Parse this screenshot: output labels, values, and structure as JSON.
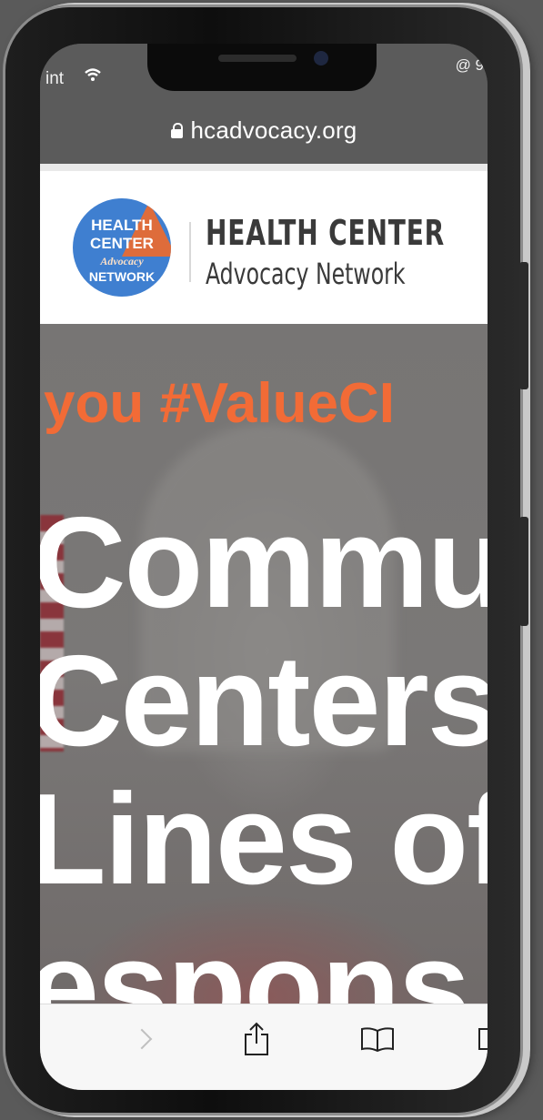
{
  "status_bar": {
    "carrier": "int",
    "battery": "@ 9"
  },
  "url_bar": {
    "domain": "hcadvocacy.org"
  },
  "logo": {
    "line1": "HEALTH",
    "line2": "CENTER",
    "line3": "Advocacy",
    "line4": "NETWORK"
  },
  "brand": {
    "title": "HEALTH CENTER",
    "subtitle": "Advocacy Network"
  },
  "hero": {
    "tagline": "you #ValueCI",
    "headline_lines": [
      "Commu",
      "Centers",
      "Lines of",
      "espons"
    ]
  },
  "toolbar": {
    "items": [
      "forward-icon",
      "share-icon",
      "bookmarks-icon",
      "tabs-icon"
    ]
  },
  "colors": {
    "accent_orange": "#f26b36",
    "logo_blue": "#3f7fd0",
    "brand_text": "#3a3a3a"
  }
}
